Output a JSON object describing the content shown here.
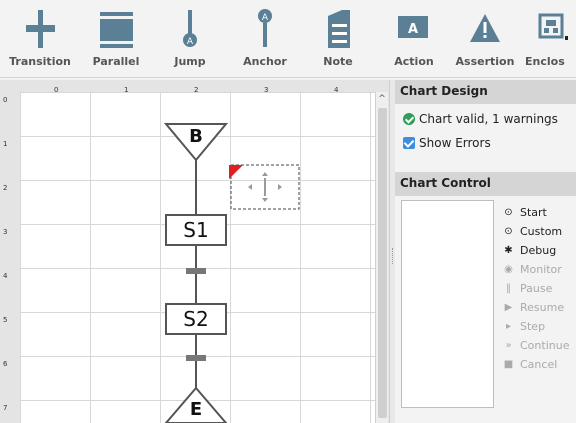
{
  "toolbar": {
    "items": [
      {
        "label": "Transition",
        "icon": "transition-icon"
      },
      {
        "label": "Parallel",
        "icon": "parallel-icon"
      },
      {
        "label": "Jump",
        "icon": "jump-icon"
      },
      {
        "label": "Anchor",
        "icon": "anchor-icon"
      },
      {
        "label": "Note",
        "icon": "note-icon"
      },
      {
        "label": "Action",
        "icon": "action-icon"
      },
      {
        "label": "Assertion",
        "icon": "assertion-icon"
      },
      {
        "label": "Enclos",
        "icon": "enclosure-icon"
      }
    ],
    "icon_color": "#5b7f95"
  },
  "canvas": {
    "col_labels": [
      "0",
      "1",
      "2",
      "3",
      "4"
    ],
    "row_labels": [
      "0",
      "1",
      "2",
      "3",
      "4",
      "5",
      "6",
      "7"
    ],
    "begin_label": "B",
    "steps": [
      "S1",
      "S2"
    ],
    "end_label": "E",
    "warning_color": "#e02020"
  },
  "chart_design": {
    "title": "Chart Design",
    "status": "Chart valid, 1 warnings",
    "show_errors_label": "Show Errors",
    "show_errors_checked": true
  },
  "chart_control": {
    "title": "Chart Control",
    "buttons": [
      {
        "label": "Start",
        "icon": "play-circle-icon",
        "enabled": true
      },
      {
        "label": "Custom",
        "icon": "play-circle-icon",
        "enabled": true
      },
      {
        "label": "Debug",
        "icon": "bug-icon",
        "enabled": true
      },
      {
        "label": "Monitor",
        "icon": "eye-icon",
        "enabled": false
      },
      {
        "label": "Pause",
        "icon": "pause-icon",
        "enabled": false
      },
      {
        "label": "Resume",
        "icon": "play-icon",
        "enabled": false
      },
      {
        "label": "Step",
        "icon": "step-icon",
        "enabled": false
      },
      {
        "label": "Continue",
        "icon": "fast-forward-icon",
        "enabled": false
      },
      {
        "label": "Cancel",
        "icon": "stop-icon",
        "enabled": false
      }
    ]
  }
}
